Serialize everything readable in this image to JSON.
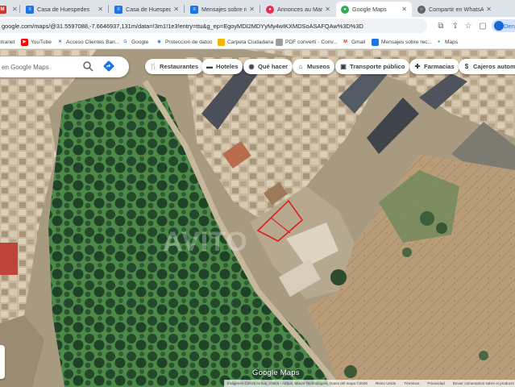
{
  "browser": {
    "tabs": [
      {
        "title": "",
        "favicon": "mail",
        "color": "#d93025",
        "active": false
      },
      {
        "title": "Casa de Huespedes",
        "favicon": "doc",
        "color": "#1a73e8",
        "active": false
      },
      {
        "title": "Casa de Huespedes",
        "favicon": "doc",
        "color": "#1a73e8",
        "active": false
      },
      {
        "title": "Mensajes sobre reci",
        "favicon": "doc",
        "color": "#1a73e8",
        "active": false
      },
      {
        "title": "Annonces au Maroc",
        "favicon": "avito",
        "color": "#e52d52",
        "active": false
      },
      {
        "title": "Google Maps",
        "favicon": "maps",
        "color": "#34a853",
        "active": true
      },
      {
        "title": "Compartir en WhatsA",
        "favicon": "globe",
        "color": "#5f6368",
        "active": false
      }
    ],
    "address": "google.com/maps/@31.5597088,-7.6646937,131m/data=!3m1!1e3!entry=ttu&g_ep=EgoyMDI2MDYyMy4wIKXMDSoASAFQAw%3D%3D",
    "profile_label": "Den"
  },
  "bookmarks": [
    {
      "label": "ntranet",
      "icon": "",
      "color": "#5f6368"
    },
    {
      "label": "YouTube",
      "icon": "▶",
      "color": "#ff0000"
    },
    {
      "label": "Acceso Clientes Ban...",
      "icon": "✕",
      "color": "#1a73e8"
    },
    {
      "label": "Google",
      "icon": "G",
      "color": "#4285f4"
    },
    {
      "label": "Proteccion de datos",
      "icon": "◉",
      "color": "#1a73e8"
    },
    {
      "label": "Carpeta Ciudadana",
      "icon": "■",
      "color": "#f4b400"
    },
    {
      "label": "PDF convertí - Conv...",
      "icon": "■",
      "color": "#9e9e9e"
    },
    {
      "label": "Gmail",
      "icon": "M",
      "color": "#d93025"
    },
    {
      "label": "Mensajes sobre rec...",
      "icon": "■",
      "color": "#1a73e8"
    },
    {
      "label": "Maps",
      "icon": "●",
      "color": "#34a853"
    }
  ],
  "maps": {
    "search_placeholder": "en Google Maps",
    "chips": [
      {
        "label": "Restaurantes",
        "icon": "restaurant-icon",
        "glyph": "🍴"
      },
      {
        "label": "Hoteles",
        "icon": "hotel-icon",
        "glyph": "🛏"
      },
      {
        "label": "Qué hacer",
        "icon": "camera-icon",
        "glyph": "📷"
      },
      {
        "label": "Museos",
        "icon": "museum-icon",
        "glyph": "🏛"
      },
      {
        "label": "Transporte público",
        "icon": "transit-icon",
        "glyph": "🚉"
      },
      {
        "label": "Farmacias",
        "icon": "pharmacy-icon",
        "glyph": "✚"
      },
      {
        "label": "Cajeros autom",
        "icon": "atm-icon",
        "glyph": "$"
      }
    ],
    "logo": "Google Maps",
    "watermark": "AVITO",
    "attribution": [
      "Imágenes ©2026 Airbus, CNES / Airbus, Maxar Technologies, Datos del mapa ©2026",
      "Reino Unido",
      "Términos",
      "Privacidad",
      "Enviar comentarios sobre el producto",
      "2 m"
    ]
  },
  "colors": {
    "tabstrip": "#dee3ea",
    "accent": "#1a73e8",
    "parcel": "#e02020",
    "vegetation": "#2e6a3c"
  }
}
